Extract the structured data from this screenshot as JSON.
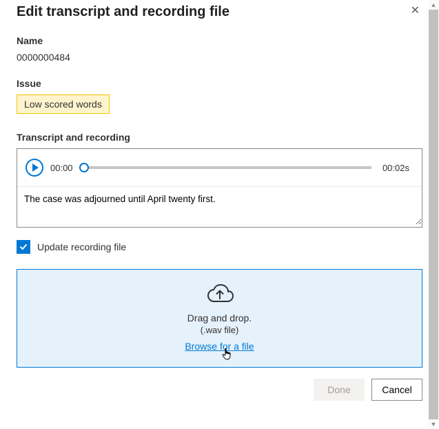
{
  "header": {
    "title": "Edit transcript and recording file"
  },
  "name": {
    "label": "Name",
    "value": "0000000484"
  },
  "issue": {
    "label": "Issue",
    "tag": "Low scored words"
  },
  "transcript": {
    "label": "Transcript and recording",
    "currentTime": "00:00",
    "duration": "00:02s",
    "text": "The case was adjourned until April twenty first."
  },
  "update": {
    "label": "Update recording file",
    "checked": true
  },
  "dropzone": {
    "line1": "Drag and drop.",
    "line2": "(.wav file)",
    "browse": "Browse for a file"
  },
  "footer": {
    "done": "Done",
    "cancel": "Cancel"
  },
  "colors": {
    "accent": "#0078d4",
    "warnBg": "#fff4ce",
    "dropBg": "#e5f1fb"
  }
}
